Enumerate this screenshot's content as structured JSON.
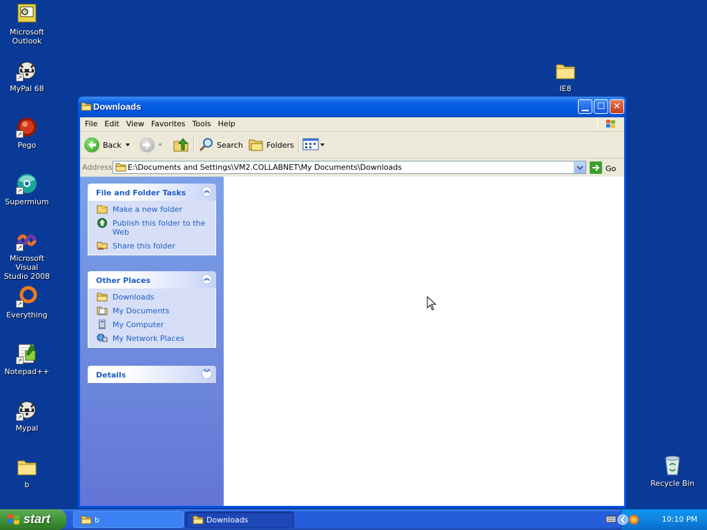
{
  "desktop": {
    "icons": [
      {
        "label": "Microsoft\nOutlook"
      },
      {
        "label": "MyPal 68"
      },
      {
        "label": "Pego"
      },
      {
        "label": "Supermium"
      },
      {
        "label": "Microsoft Visual\nStudio 2008"
      },
      {
        "label": "Everything"
      },
      {
        "label": "Notepad++"
      },
      {
        "label": "Mypal"
      },
      {
        "label": "b"
      },
      {
        "label": "IE8"
      },
      {
        "label": "Recycle Bin"
      }
    ]
  },
  "window": {
    "title": "Downloads",
    "menu": [
      "File",
      "Edit",
      "View",
      "Favorites",
      "Tools",
      "Help"
    ],
    "toolbar": {
      "back": "Back",
      "search": "Search",
      "folders": "Folders"
    },
    "address": {
      "label": "Address",
      "value": "E:\\Documents and Settings\\VM2.COLLABNET\\My Documents\\Downloads",
      "go": "Go"
    },
    "panels": {
      "tasks": {
        "title": "File and Folder Tasks",
        "items": [
          "Make a new folder",
          "Publish this folder to the Web",
          "Share this folder"
        ]
      },
      "places": {
        "title": "Other Places",
        "items": [
          "Downloads",
          "My Documents",
          "My Computer",
          "My Network Places"
        ]
      },
      "details": {
        "title": "Details"
      }
    }
  },
  "taskbar": {
    "start": "start",
    "buttons": [
      "b",
      "Downloads"
    ],
    "clock": "10:10 PM"
  },
  "colors": {
    "desktop": "#0a3a97",
    "link": "#215dc6",
    "taskbar": "#245edb",
    "start": "#3c8f33"
  }
}
